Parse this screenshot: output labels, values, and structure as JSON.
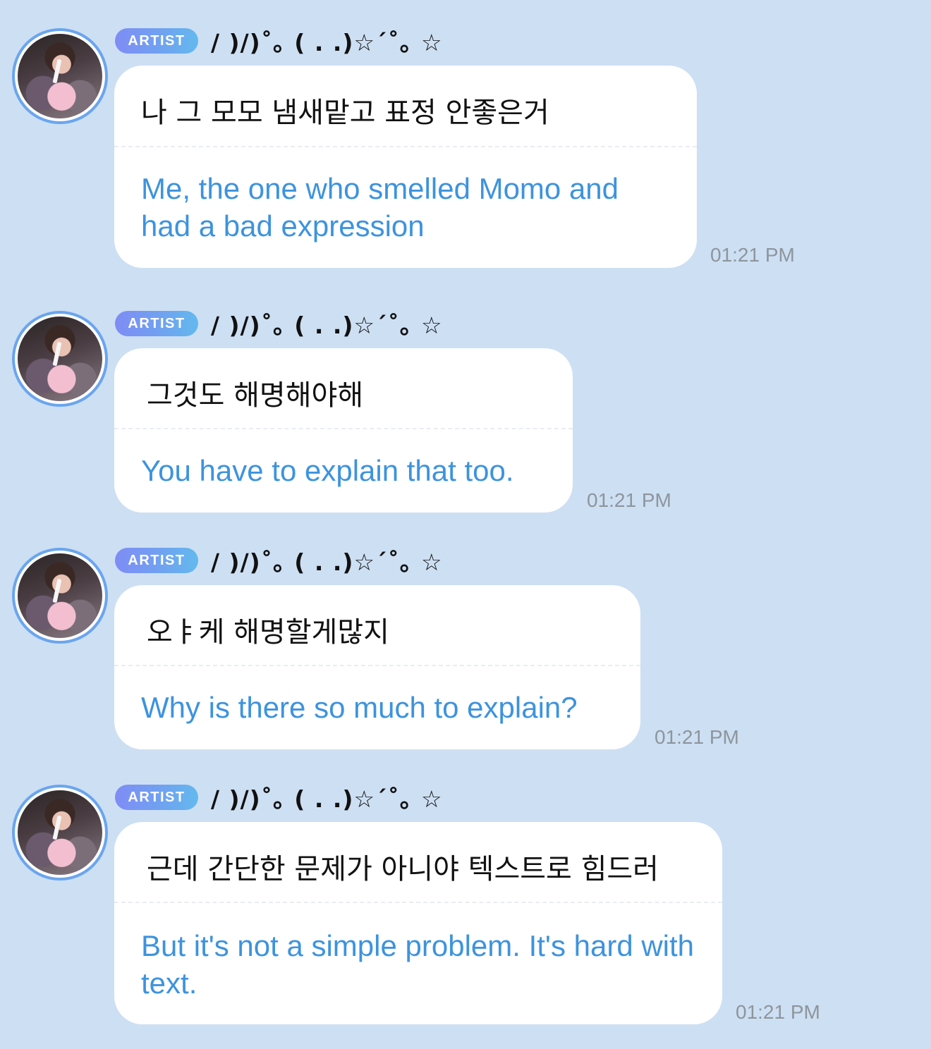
{
  "messages": [
    {
      "badge": "ARTIST",
      "nickname": "/ )/)˚｡ (  . .)☆´˚｡ ☆",
      "korean": "나 그 모모 냄새맡고 표정 안좋은거",
      "translation": "Me, the one who smelled Momo and had a bad expression",
      "time": "01:21 PM"
    },
    {
      "badge": "ARTIST",
      "nickname": "/ )/)˚｡ (  . .)☆´˚｡ ☆",
      "korean": "그것도 해명해야해",
      "translation": "You have to explain that too.",
      "time": "01:21 PM"
    },
    {
      "badge": "ARTIST",
      "nickname": "/ )/)˚｡ (  . .)☆´˚｡ ☆",
      "korean": "오ㅑ케 해명할게많지",
      "translation": "Why is there so much to explain?",
      "time": "01:21 PM"
    },
    {
      "badge": "ARTIST",
      "nickname": "/ )/)˚｡ (  . .)☆´˚｡ ☆",
      "korean": "근데 간단한 문제가 아니야 텍스트로 힘드러",
      "translation": "But it's not a simple problem. It's hard with text.",
      "time": "01:21 PM"
    }
  ]
}
